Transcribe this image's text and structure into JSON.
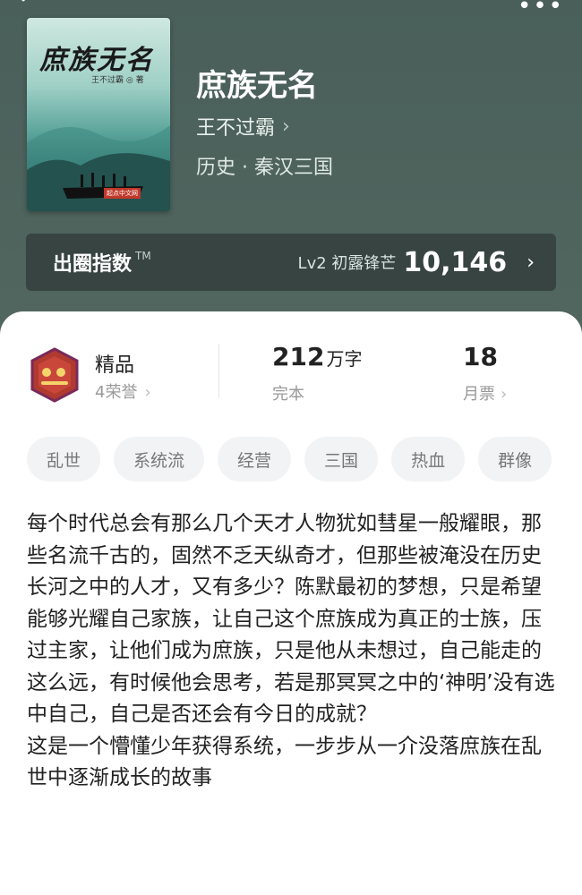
{
  "book": {
    "cover_title": "庶族无名",
    "cover_author": "王不过霸 ◎ 著",
    "cover_publisher": "起点中文网",
    "title": "庶族无名",
    "author": "王不过霸",
    "category": "历史 · 秦汉三国"
  },
  "index_bar": {
    "label": "出圈指数",
    "tm": "TM",
    "level": "Lv2 初露锋芒",
    "value": "10,146"
  },
  "stats": {
    "quality": "精品",
    "honors": "4荣誉",
    "word_count": "212",
    "word_unit": "万字",
    "status": "完本",
    "monthly_tickets": "18",
    "monthly_tickets_label": "月票"
  },
  "tags": [
    "乱世",
    "系统流",
    "经营",
    "三国",
    "热血",
    "群像"
  ],
  "description": [
    "每个时代总会有那么几个天才人物犹如彗星一般耀眼，那些名流千古的，固然不乏天纵奇才，但那些被淹没在历史长河之中的人才，又有多少？陈默最初的梦想，只是希望能够光耀自己家族，让自己这个庶族成为真正的士族，压过主家，让他们成为庶族，只是他从未想过，自己能走的这么远，有时候他会思考，若是那冥冥之中的‘神明’没有选中自己，自己是否还会有今日的成就？",
    "这是一个懵懂少年获得系统，一步步从一介没落庶族在乱世中逐渐成长的故事"
  ],
  "colors": {
    "header_bg": "#4f645e",
    "card_bg": "#ffffff",
    "tag_bg": "#f2f3f4",
    "badge_red": "#b03a2e"
  }
}
